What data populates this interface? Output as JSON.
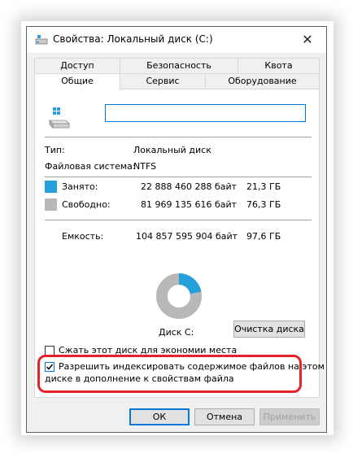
{
  "window": {
    "title": "Свойства: Локальный диск (C:)",
    "close_symbol": "✕"
  },
  "tabs": {
    "row1": [
      "Доступ",
      "Безопасность",
      "Квота"
    ],
    "row2": [
      "Общие",
      "Сервис",
      "Оборудование"
    ],
    "active": "Общие"
  },
  "general": {
    "name_value": "",
    "type_label": "Тип:",
    "type_value": "Локальный диск",
    "fs_label": "Файловая система:",
    "fs_value": "NTFS",
    "used_label": "Занято:",
    "used_bytes": "22 888 460 288 байт",
    "used_gb": "21,3 ГБ",
    "free_label": "Свободно:",
    "free_bytes": "81 969 135 616 байт",
    "free_gb": "76,3 ГБ",
    "capacity_label": "Емкость:",
    "capacity_bytes": "104 857 595 904 байт",
    "capacity_gb": "97,6 ГБ",
    "drive_caption": "Диск C:",
    "cleanup_button": "Очистка диска",
    "compress_label": "Сжать этот диск для экономии места",
    "compress_checked": false,
    "index_label_line1": "Разрешить индексировать содержимое файлов на этом",
    "index_label_line2": "диске в дополнение к свойствам файла",
    "index_checked": true,
    "used_fraction": 0.218
  },
  "colors": {
    "used": "#26a0da",
    "free": "#b8b8b8",
    "highlight": "#e3222a",
    "accent": "#0078d7"
  },
  "footer": {
    "ok": "ОК",
    "cancel": "Отмена",
    "apply": "Применить"
  },
  "icons": [
    "drive-icon",
    "close-icon",
    "check-icon",
    "windows-logo-icon"
  ]
}
